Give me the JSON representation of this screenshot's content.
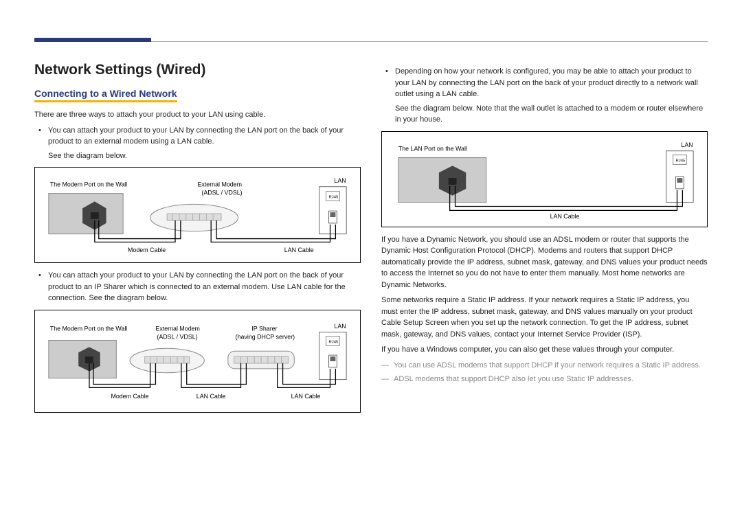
{
  "heading": "Network Settings (Wired)",
  "subheading": "Connecting to a Wired Network",
  "intro": "There are three ways to attach your product to your LAN using cable.",
  "left_bullet1": "You can attach your product to your LAN by connecting the LAN port on the back of your product to an external modem using a LAN cable.",
  "see_diagram": "See the diagram below.",
  "left_bullet2": "You can attach your product to your LAN by connecting the LAN port on the back of your product to an IP Sharer which is connected to an external modem. Use LAN cable for the connection. See the diagram below.",
  "right_bullet": "Depending on how your network is configured, you may be able to attach your product to your LAN by connecting the LAN port on the back of your product directly to a network wall outlet using a LAN cable.",
  "right_bullet_note": "See the diagram below. Note that the wall outlet is attached to a modem or router elsewhere in your house.",
  "para_dhcp": "If you have a Dynamic Network, you should use an ADSL modem or router that supports the Dynamic Host Configuration Protocol (DHCP). Modems and routers that support DHCP automatically provide the IP address, subnet mask, gateway, and DNS values your product needs to access the Internet so you do not have to enter them manually. Most home networks are Dynamic Networks.",
  "para_static": "Some networks require a Static IP address. If your network requires a Static IP address, you must enter the IP address, subnet mask, gateway, and DNS values manually on your product Cable Setup Screen when you set up the network connection. To get the IP address, subnet mask, gateway, and DNS values, contact your Internet Service Provider (ISP).",
  "para_windows": "If you have a Windows computer, you can also get these values through your computer.",
  "note1": "You can use ADSL modems that support DHCP if your network requires a Static IP address.",
  "note2": "ADSL modems that support DHCP also let you use Static IP addresses.",
  "diag1": {
    "wall_label": "The Modem Port on the Wall",
    "modem_label": "External Modem",
    "modem_sublabel": "(ADSL / VDSL)",
    "lan": "LAN",
    "rj45": "RJ45",
    "modem_cable": "Modem Cable",
    "lan_cable": "LAN Cable"
  },
  "diag2": {
    "wall_label": "The Modem Port on the Wall",
    "modem_label": "External Modem",
    "modem_sublabel": "(ADSL / VDSL)",
    "sharer_label": "IP Sharer",
    "sharer_sublabel": "(having DHCP server)",
    "lan": "LAN",
    "rj45": "RJ45",
    "modem_cable": "Modem Cable",
    "lan_cable": "LAN Cable"
  },
  "diag3": {
    "wall_label": "The LAN Port on the Wall",
    "lan": "LAN",
    "rj45": "RJ45",
    "lan_cable": "LAN Cable"
  }
}
